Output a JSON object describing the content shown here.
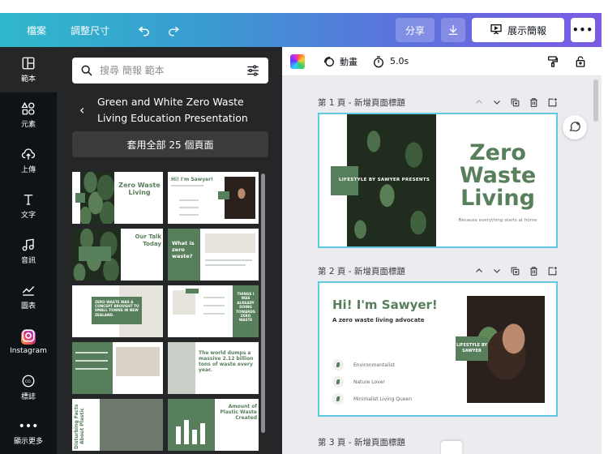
{
  "topbar": {
    "menu_file": "檔案",
    "menu_resize": "調整尺寸",
    "share_label": "分享",
    "present_label": "展示簡報"
  },
  "rail": {
    "items": [
      {
        "label": "範本",
        "icon": "template-icon"
      },
      {
        "label": "元素",
        "icon": "elements-icon"
      },
      {
        "label": "上傳",
        "icon": "upload-icon"
      },
      {
        "label": "文字",
        "icon": "text-icon"
      },
      {
        "label": "音訊",
        "icon": "music-icon"
      },
      {
        "label": "圖表",
        "icon": "chart-icon"
      },
      {
        "label": "Instagram",
        "icon": "instagram-icon"
      },
      {
        "label": "標誌",
        "icon": "logo-icon"
      },
      {
        "label": "顯示更多",
        "icon": "more-icon"
      }
    ]
  },
  "panel": {
    "search_placeholder": "搜尋 簡報 範本",
    "template_title": "Green and White Zero Waste Living Education Presentation",
    "apply_all_label": "套用全部 25 個頁面",
    "thumbs": {
      "t1": "Zero Waste Living",
      "t2": "Hi! I'm Sawyer!",
      "t3": "Our Talk Today",
      "t4": "What is zero waste?",
      "t5": "ZERO WASTE WAS A CONCEPT BROUGHT TO SMALL TOWNS IN NEW ZEALAND.",
      "t6": "THINGS I WAS ALREADY DOING TOWARDS ZERO WASTE",
      "t8": "The world dumps a massive 2.12 billion tons of waste every year.",
      "t9": "Disturbing Facts About Plastic",
      "t10": "Amount of Plastic Waste Created"
    }
  },
  "editor": {
    "animate_label": "動畫",
    "duration_label": "5.0s",
    "pages": [
      {
        "header": "第 1 頁 - 新增頁面標題"
      },
      {
        "header": "第 2 頁 - 新增頁面標題"
      }
    ],
    "page3_header": "第 3 頁 - 新增頁面標題"
  },
  "slide1": {
    "label": "LIFESTYLE BY SAWYER PRESENTS",
    "title": "Zero Waste Living",
    "subtitle": "Because everything starts at home"
  },
  "slide2": {
    "title": "Hi! I'm Sawyer!",
    "subtitle": "A zero waste living advocate",
    "items": [
      "Environmentalist",
      "Nature Lover",
      "Minimalist Living Queen"
    ],
    "label": "LIFESTYLE BY SAWYER"
  },
  "colors": {
    "accent_green": "#587f5b",
    "selection": "#5fcadd",
    "rail_bg": "#0e1318",
    "panel_bg": "#252627"
  }
}
